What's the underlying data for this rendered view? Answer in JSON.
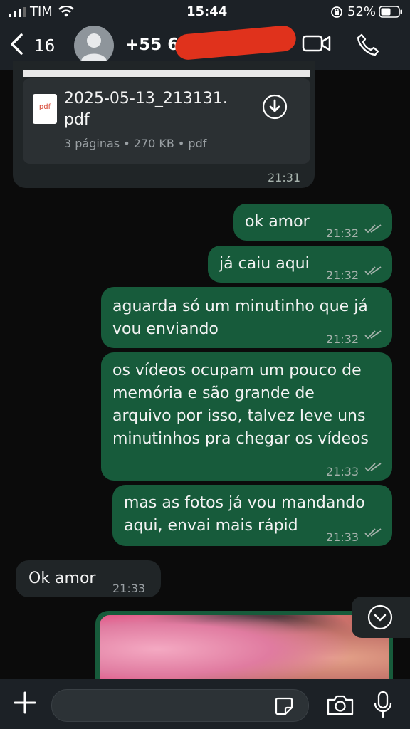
{
  "status": {
    "carrier": "TIM",
    "time": "15:44",
    "battery": "52%"
  },
  "header": {
    "back_count": "16",
    "contact_name": "+55 61"
  },
  "document": {
    "filename_line1": "2025-05-13_213131.",
    "filename_line2": "pdf",
    "meta": "3 páginas • 270 KB • pdf",
    "time": "21:31"
  },
  "messages": [
    {
      "text": "ok amor",
      "time": "21:32"
    },
    {
      "text": "já caiu aqui",
      "time": "21:32"
    },
    {
      "lines": [
        "aguarda só um minutinho que já",
        "vou enviando"
      ],
      "time": "21:32"
    },
    {
      "lines": [
        "os vídeos ocupam um pouco de",
        "memória e são grande de",
        "arquivo por isso, talvez leve uns",
        "minutinhos pra chegar os vídeos"
      ],
      "time": "21:33"
    },
    {
      "lines": [
        "mas as fotos já vou mandando",
        "aqui, envai mais rápid"
      ],
      "time": "21:33"
    },
    {
      "text": "Ok amor",
      "time": "21:33"
    }
  ],
  "colors": {
    "outgoing": "#175b3b",
    "incoming": "#202527",
    "read_ticks": "#a7b3ad"
  }
}
